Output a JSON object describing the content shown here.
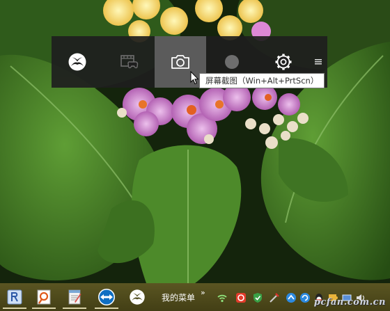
{
  "game_bar": {
    "buttons": [
      {
        "icon": "xbox-icon"
      },
      {
        "icon": "game-clip-icon"
      },
      {
        "icon": "camera-icon",
        "active": true
      },
      {
        "icon": "record-icon"
      },
      {
        "icon": "gear-icon"
      }
    ],
    "menu_icon": "drag-handle-icon",
    "tooltip": "屏幕截图（Win+Alt+PrtScn）"
  },
  "taskbar": {
    "apps": [
      {
        "name": "start",
        "icon": "r-app-icon"
      },
      {
        "name": "screenshot-tool",
        "icon": "pin-app-icon"
      },
      {
        "name": "notepad",
        "icon": "notepad-icon"
      },
      {
        "name": "teamviewer",
        "icon": "teamviewer-icon"
      },
      {
        "name": "xbox",
        "icon": "xbox-icon"
      }
    ],
    "menu_label": "我的菜单",
    "chevron": "»",
    "tray_icons": [
      "wifi-icon",
      "antivirus-icon",
      "shield-icon",
      "tool-icon",
      "arrow-icon",
      "refresh-icon",
      "qq-icon",
      "puzzle-icon",
      "network-icon",
      "volume-icon"
    ]
  },
  "watermark": "pcfan.com.cn",
  "colors": {
    "game_bar_bg": "#1e1e1e",
    "active_button": "#5f5f5f",
    "taskbar": "#4e4a1c"
  }
}
